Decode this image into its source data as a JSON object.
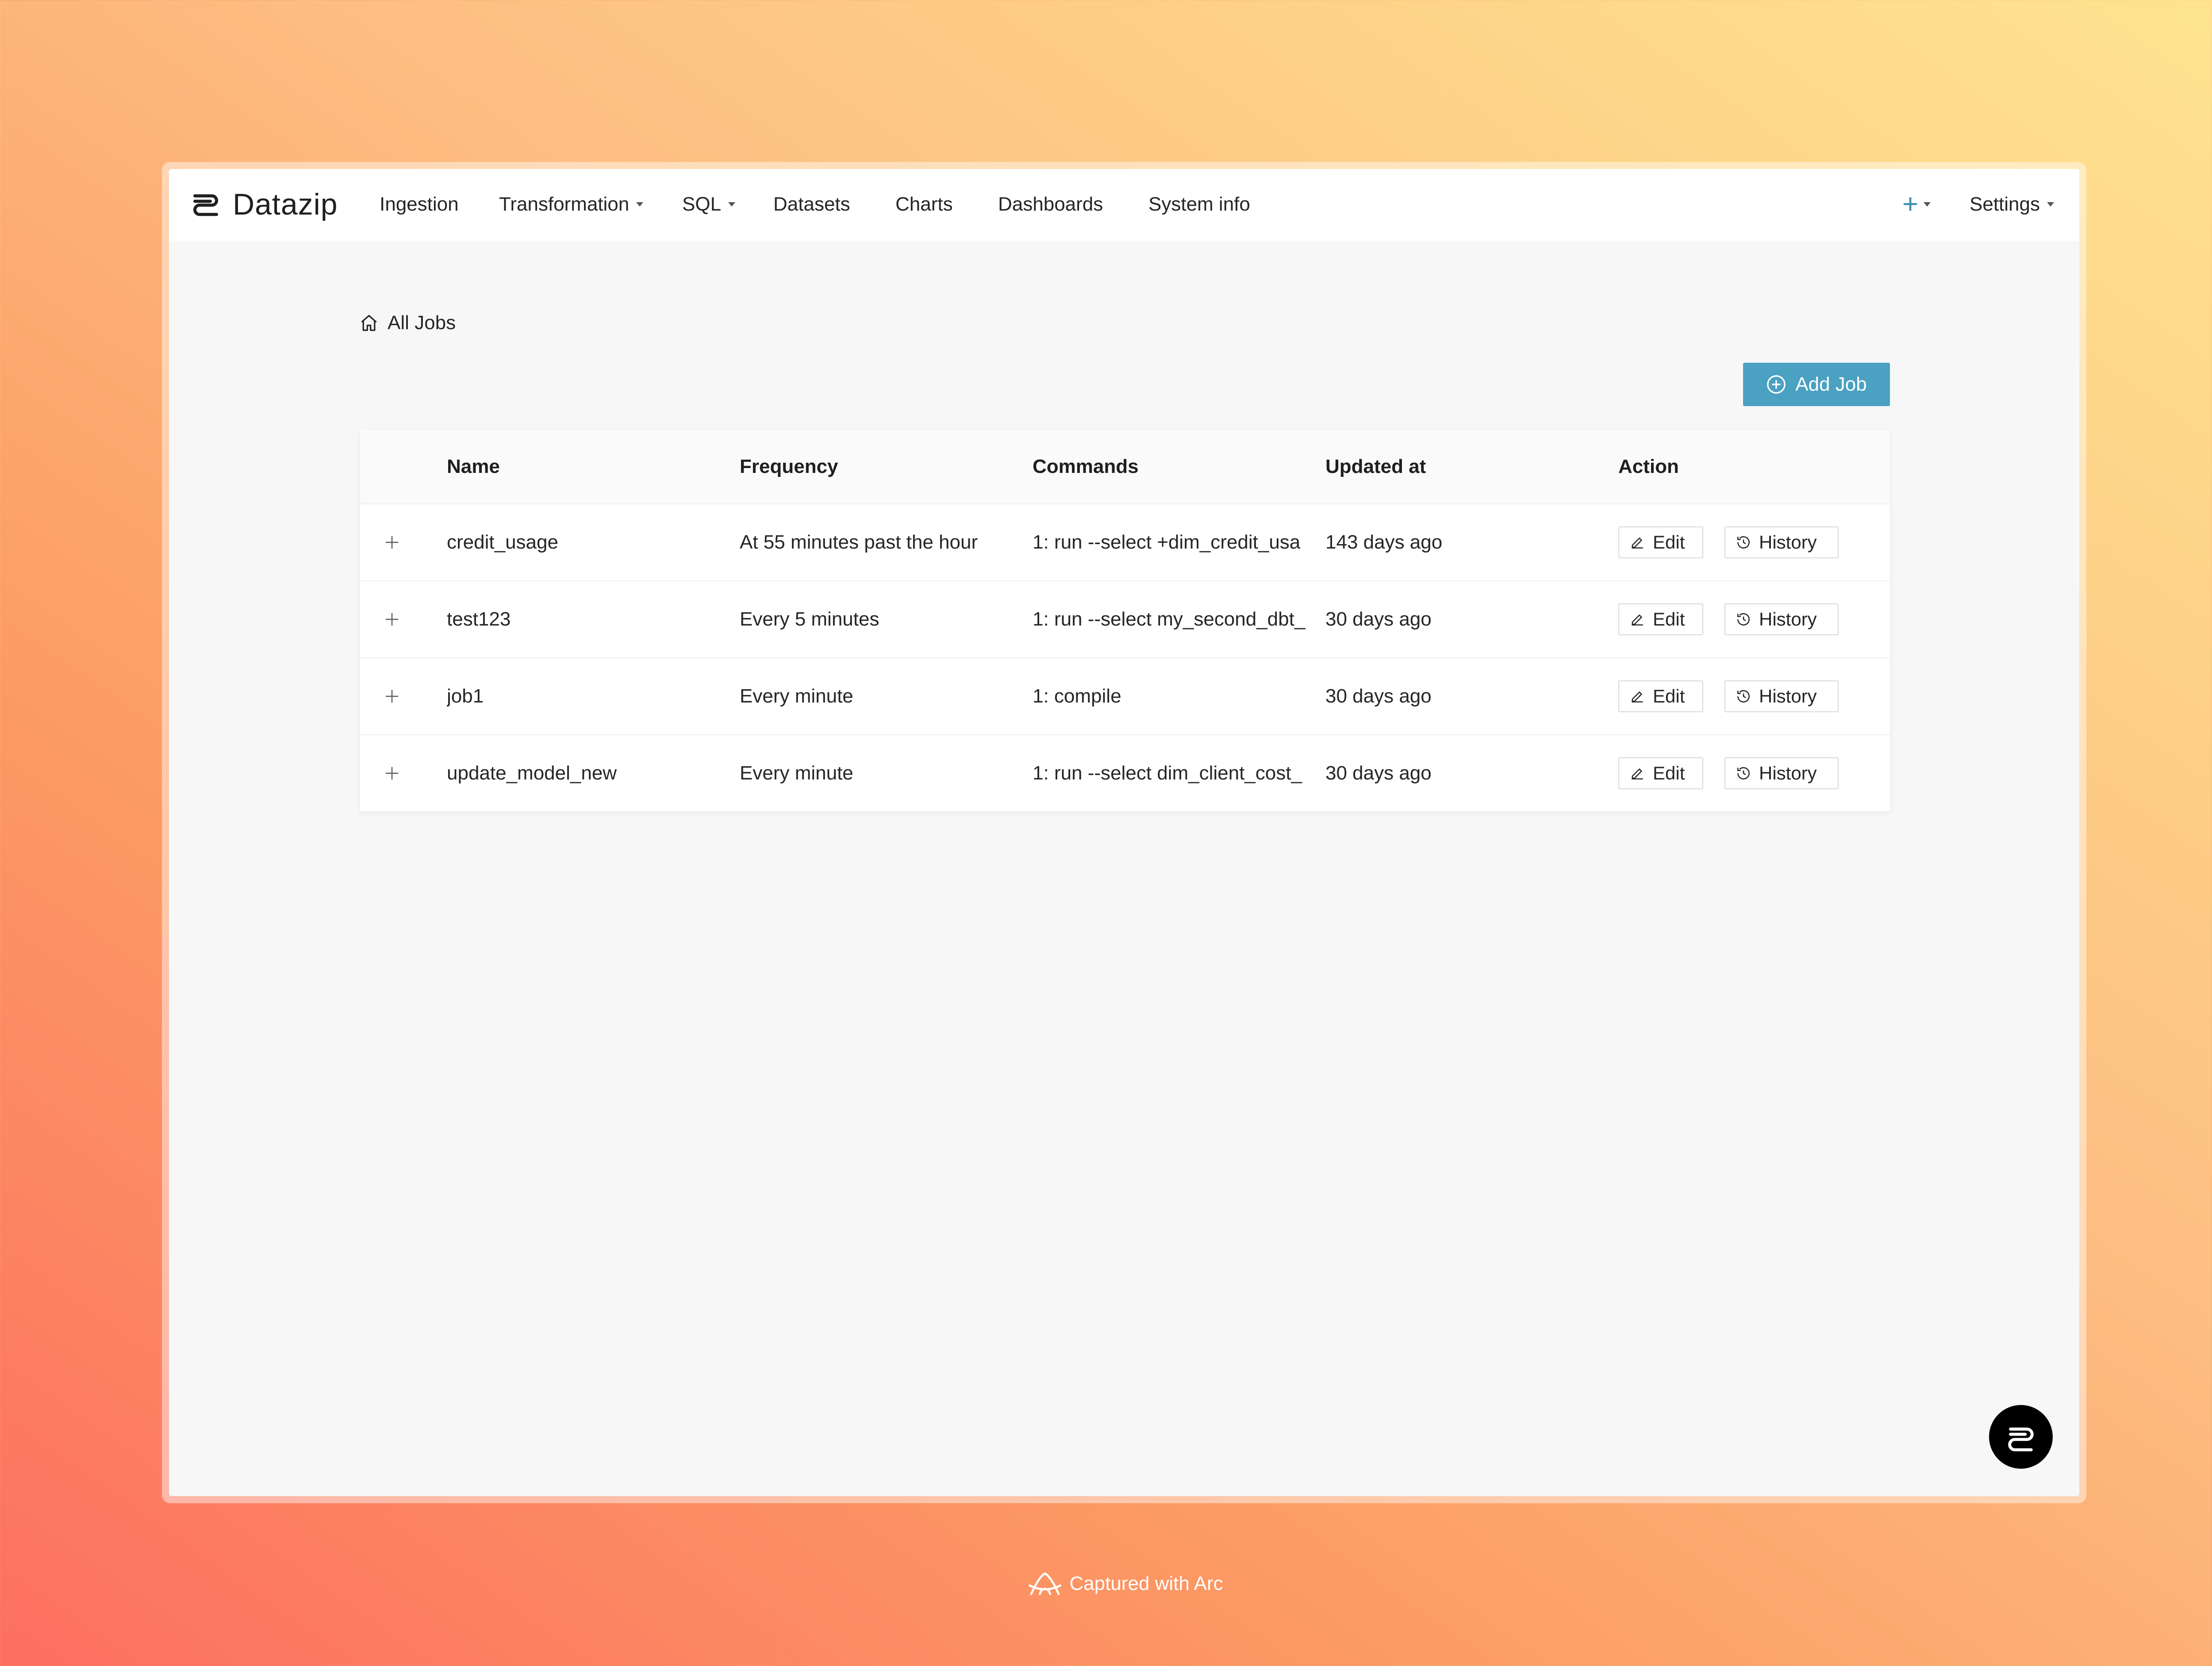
{
  "app": {
    "brand": "Datazip"
  },
  "nav": {
    "items": [
      {
        "label": "Ingestion",
        "dropdown": false
      },
      {
        "label": "Transformation",
        "dropdown": true
      },
      {
        "label": "SQL",
        "dropdown": true
      },
      {
        "label": "Datasets",
        "dropdown": false
      },
      {
        "label": "Charts",
        "dropdown": false
      },
      {
        "label": "Dashboards",
        "dropdown": false
      },
      {
        "label": "System info",
        "dropdown": false
      }
    ],
    "right": {
      "plus_icon": "plus-icon",
      "settings_label": "Settings"
    }
  },
  "breadcrumb": {
    "icon": "home-icon",
    "label": "All Jobs"
  },
  "actions": {
    "add_job_label": "Add Job",
    "add_job_icon": "plus-circle-icon",
    "accent_color": "#4aa1c2"
  },
  "table": {
    "columns": [
      "Name",
      "Frequency",
      "Commands",
      "Updated at",
      "Action"
    ],
    "rows": [
      {
        "name": "credit_usage",
        "frequency": "At 55 minutes past the hour",
        "commands": "1: run --select +dim_credit_usa",
        "updated_at": "143 days ago"
      },
      {
        "name": "test123",
        "frequency": "Every 5 minutes",
        "commands": "1: run --select my_second_dbt_",
        "updated_at": "30 days ago"
      },
      {
        "name": "job1",
        "frequency": "Every minute",
        "commands": "1: compile",
        "updated_at": "30 days ago"
      },
      {
        "name": "update_model_new",
        "frequency": "Every minute",
        "commands": "1: run --select dim_client_cost_",
        "updated_at": "30 days ago"
      }
    ],
    "edit_label": "Edit",
    "history_label": "History"
  },
  "footer": {
    "caption": "Captured with Arc"
  }
}
